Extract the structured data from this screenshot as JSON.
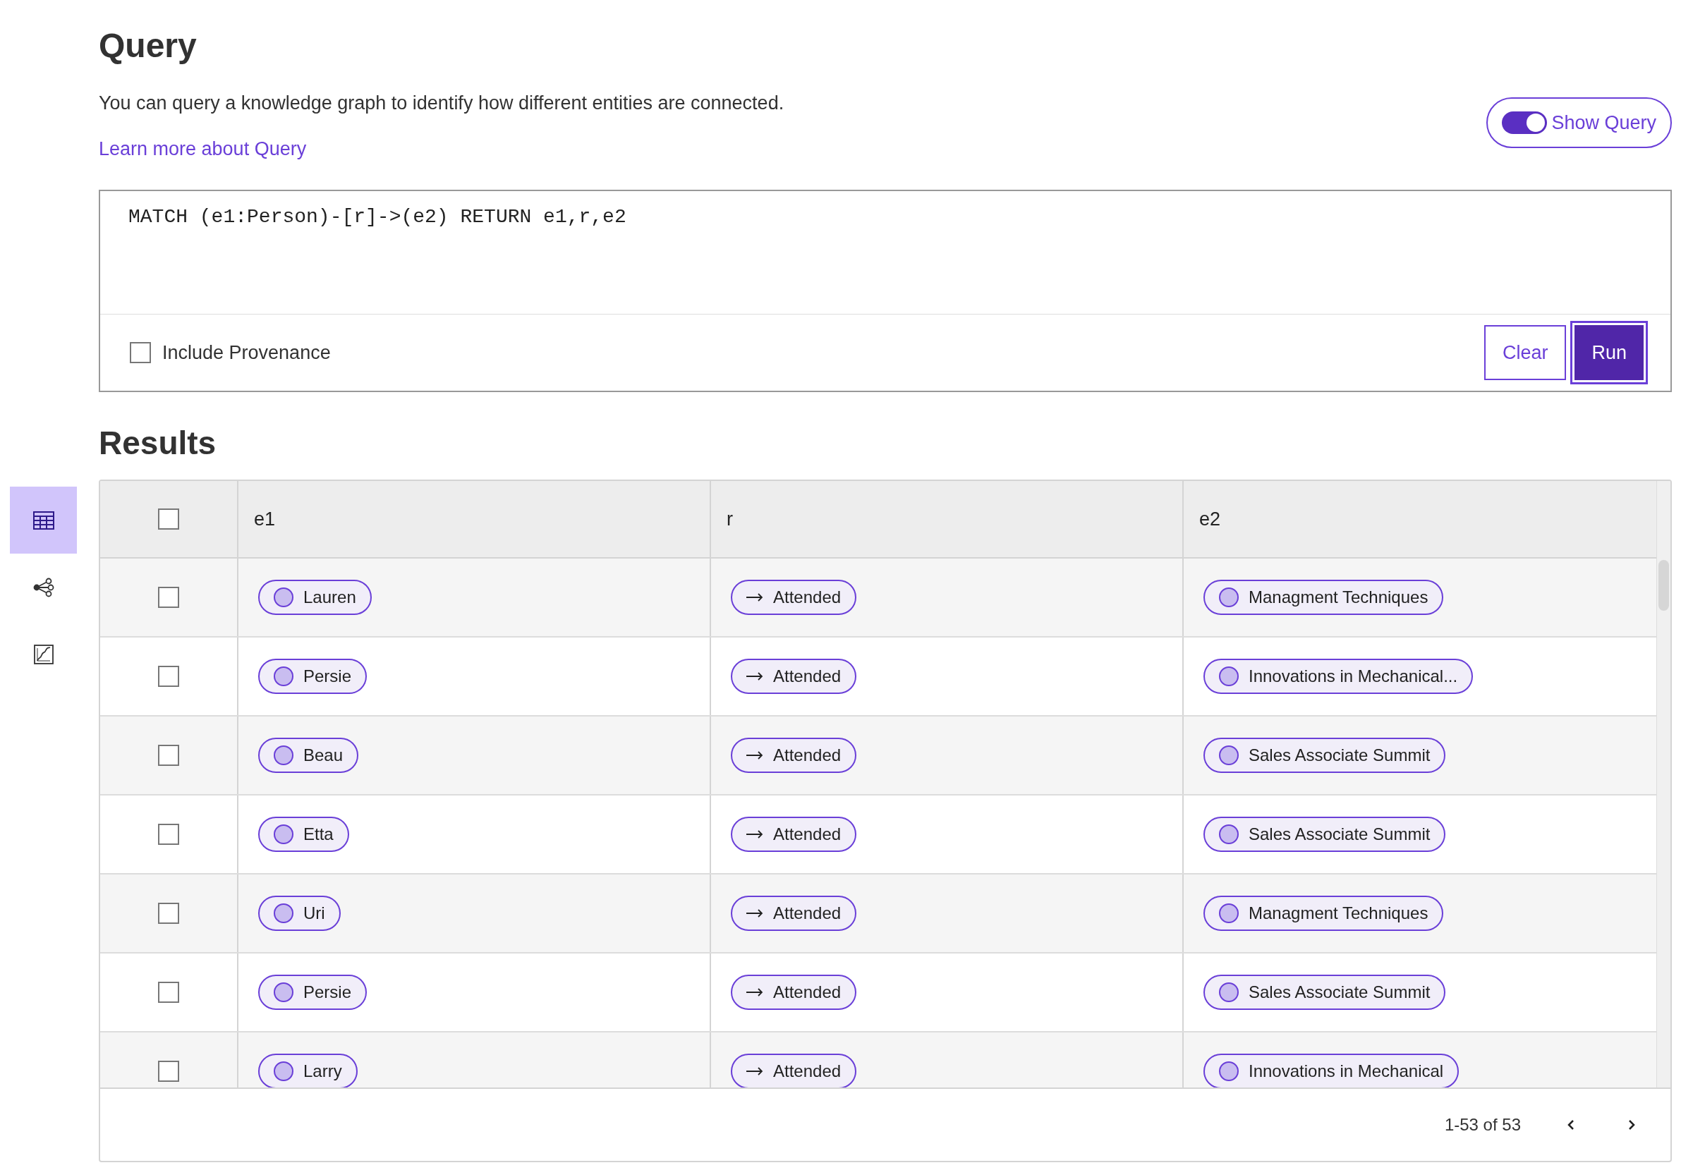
{
  "page": {
    "title": "Query",
    "description": "You can query a knowledge graph to identify how different entities are connected.",
    "link": "Learn more about Query"
  },
  "show_query": {
    "label": "Show Query",
    "on": true
  },
  "sidebar": [
    {
      "kind": "table",
      "selected": true
    },
    {
      "kind": "graph",
      "selected": false
    },
    {
      "kind": "chart",
      "selected": false
    }
  ],
  "editor": {
    "value": "MATCH (e1:Person)-[r]->(e2) RETURN e1,r,e2",
    "include_provenance": {
      "label": "Include Provenance",
      "checked": false
    },
    "buttons": [
      {
        "label": "Clear",
        "kind": "secondary"
      },
      {
        "label": "Run",
        "kind": "primary"
      }
    ]
  },
  "results": {
    "title": "Results",
    "select_all_checked": false,
    "columns": [
      "e1",
      "r",
      "e2"
    ],
    "rows": [
      {
        "checked": false,
        "e1": "Lauren",
        "r": "Attended",
        "e2": "Managment Techniques"
      },
      {
        "checked": false,
        "e1": "Persie",
        "r": "Attended",
        "e2": "Innovations in Mechanical..."
      },
      {
        "checked": false,
        "e1": "Beau",
        "r": "Attended",
        "e2": "Sales Associate Summit"
      },
      {
        "checked": false,
        "e1": "Etta",
        "r": "Attended",
        "e2": "Sales Associate Summit"
      },
      {
        "checked": false,
        "e1": "Uri",
        "r": "Attended",
        "e2": "Managment Techniques"
      },
      {
        "checked": false,
        "e1": "Persie",
        "r": "Attended",
        "e2": "Sales Associate Summit"
      },
      {
        "checked": false,
        "e1": "Larry",
        "r": "Attended",
        "e2": "Innovations in Mechanical"
      }
    ],
    "pagination": "1-53 of 53"
  }
}
